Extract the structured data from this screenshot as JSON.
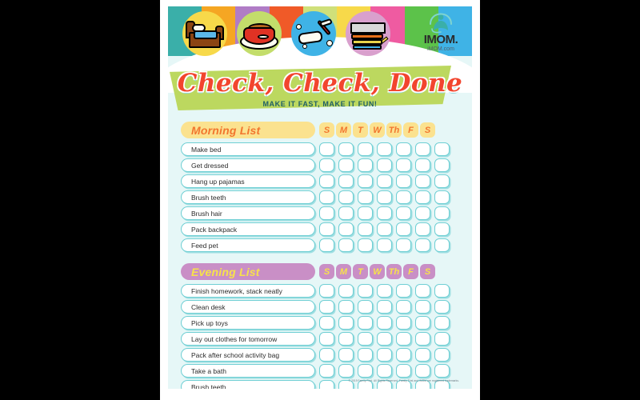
{
  "header": {
    "title": "Check, Check, Done",
    "subtitle": "MAKE IT FAST, MAKE IT FUN!",
    "stripes": [
      "#3aafa9",
      "#f5a623",
      "#b07cc6",
      "#f05a28",
      "#cfe07a",
      "#f7d94a",
      "#ef5ba1",
      "#5cc24a",
      "#3fb3e6"
    ],
    "icons": [
      {
        "name": "bed-icon",
        "circle_color": "#f7d94a"
      },
      {
        "name": "pet-bowl-icon",
        "circle_color": "#c3dd6b"
      },
      {
        "name": "soap-toothbrush-icon",
        "circle_color": "#3fb3e6"
      },
      {
        "name": "book-stack-icon",
        "circle_color": "#d9a0cd"
      }
    ],
    "banner_color": "#bcd85f",
    "title_color": "#f2452e"
  },
  "logo": {
    "wordmark": "IMOM.",
    "url": "iMOM.com",
    "swoosh_color": "#3aafa9"
  },
  "morning": {
    "title": "Morning List",
    "pill_color": "#fbe28f",
    "text_color": "#f2762e",
    "days": [
      "S",
      "M",
      "T",
      "W",
      "Th",
      "F",
      "S"
    ],
    "tasks": [
      "Make bed",
      "Get dressed",
      "Hang up pajamas",
      "Brush teeth",
      "Brush hair",
      "Pack backpack",
      "Feed pet"
    ]
  },
  "evening": {
    "title": "Evening List",
    "pill_color": "#c98fc6",
    "text_color": "#f7e24a",
    "days": [
      "S",
      "M",
      "T",
      "W",
      "Th",
      "F",
      "S"
    ],
    "tasks": [
      "Finish homework, stack neatly",
      "Clean desk",
      "Pick up toys",
      "Lay out clothes for tomorrow",
      "Pack after school activity bag",
      "Take a bath",
      "Brush teeth"
    ]
  },
  "footer": {
    "copyright": "© 2019 Family First. All Rights Reserved. Family First and iMOM are registered trademarks."
  }
}
